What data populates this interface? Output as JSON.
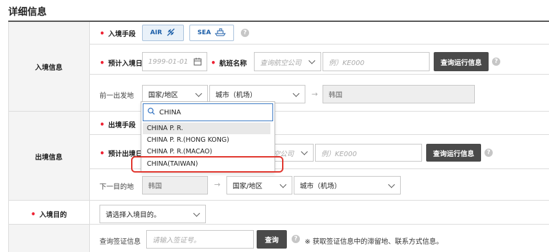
{
  "page_title": "详细信息",
  "sections": {
    "entry": "入境信息",
    "exit": "出境信息",
    "purpose": "入境目的"
  },
  "entry": {
    "mode_label": "入境手段",
    "mode_air": "AIR",
    "mode_sea": "SEA",
    "date_label": "预计入境日",
    "date_placeholder": "1999-01-01",
    "flight_label": "航班名称",
    "airline_placeholder": "查询航空公司",
    "flight_placeholder": "例）KE000",
    "query_button": "查询运行信息",
    "prev_label": "前一出发地",
    "country_select": "国家/地区",
    "city_select": "城市（机场）",
    "destination": "韩国"
  },
  "exit": {
    "mode_label": "出境手段",
    "date_label": "预计出境日",
    "airline_placeholder": "空公司",
    "flight_placeholder": "例）KE000",
    "query_button": "查询运行信息",
    "next_label": "下一目的地",
    "origin": "韩国",
    "country_select": "国家/地区",
    "city_select": "城市（机场）"
  },
  "purpose": {
    "label": "入境目的",
    "select": "请选择入境目的。"
  },
  "visa": {
    "label": "查询签证信息",
    "placeholder": "请输入签证号。",
    "button": "查询",
    "note": "※ 获取签证信息中的滞留地、联系方式信息。"
  },
  "dropdown": {
    "search_value": "CHINA",
    "options": [
      "CHINA P. R.",
      "CHINA P. R.(HONG KONG)",
      "CHINA P. R.(MACAO)",
      "CHINA(TAIWAN)"
    ]
  },
  "colors": {
    "highlight": "#e0332b",
    "accent": "#1c5ea8",
    "required": "#e23"
  }
}
